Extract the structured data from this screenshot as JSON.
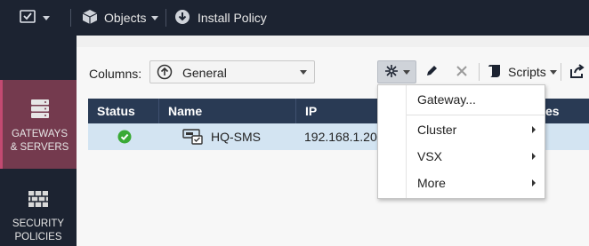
{
  "topbar": {
    "objects_label": "Objects",
    "install_policy_label": "Install Policy"
  },
  "sidebar": {
    "items": [
      {
        "label_line1": "GATEWAYS",
        "label_line2": "& SERVERS",
        "active": true
      },
      {
        "label_line1": "SECURITY",
        "label_line2": "POLICIES",
        "active": false
      }
    ]
  },
  "toolbar": {
    "columns_label": "Columns:",
    "columns_value": "General",
    "scripts_label": "Scripts"
  },
  "table": {
    "headers": [
      "Status",
      "Name",
      "IP",
      "es"
    ],
    "rows": [
      {
        "status": "ok",
        "name": "HQ-SMS",
        "ip": "192.168.1.20"
      }
    ]
  },
  "new_menu": {
    "items": [
      "Gateway...",
      "Cluster",
      "VSX",
      "More"
    ]
  },
  "colors": {
    "topbar_bg": "#1c2331",
    "active_nav_bg": "#743a4e",
    "table_header_bg": "#293a54",
    "selected_row_bg": "#d3e4f2",
    "status_ok": "#3aaa35"
  }
}
